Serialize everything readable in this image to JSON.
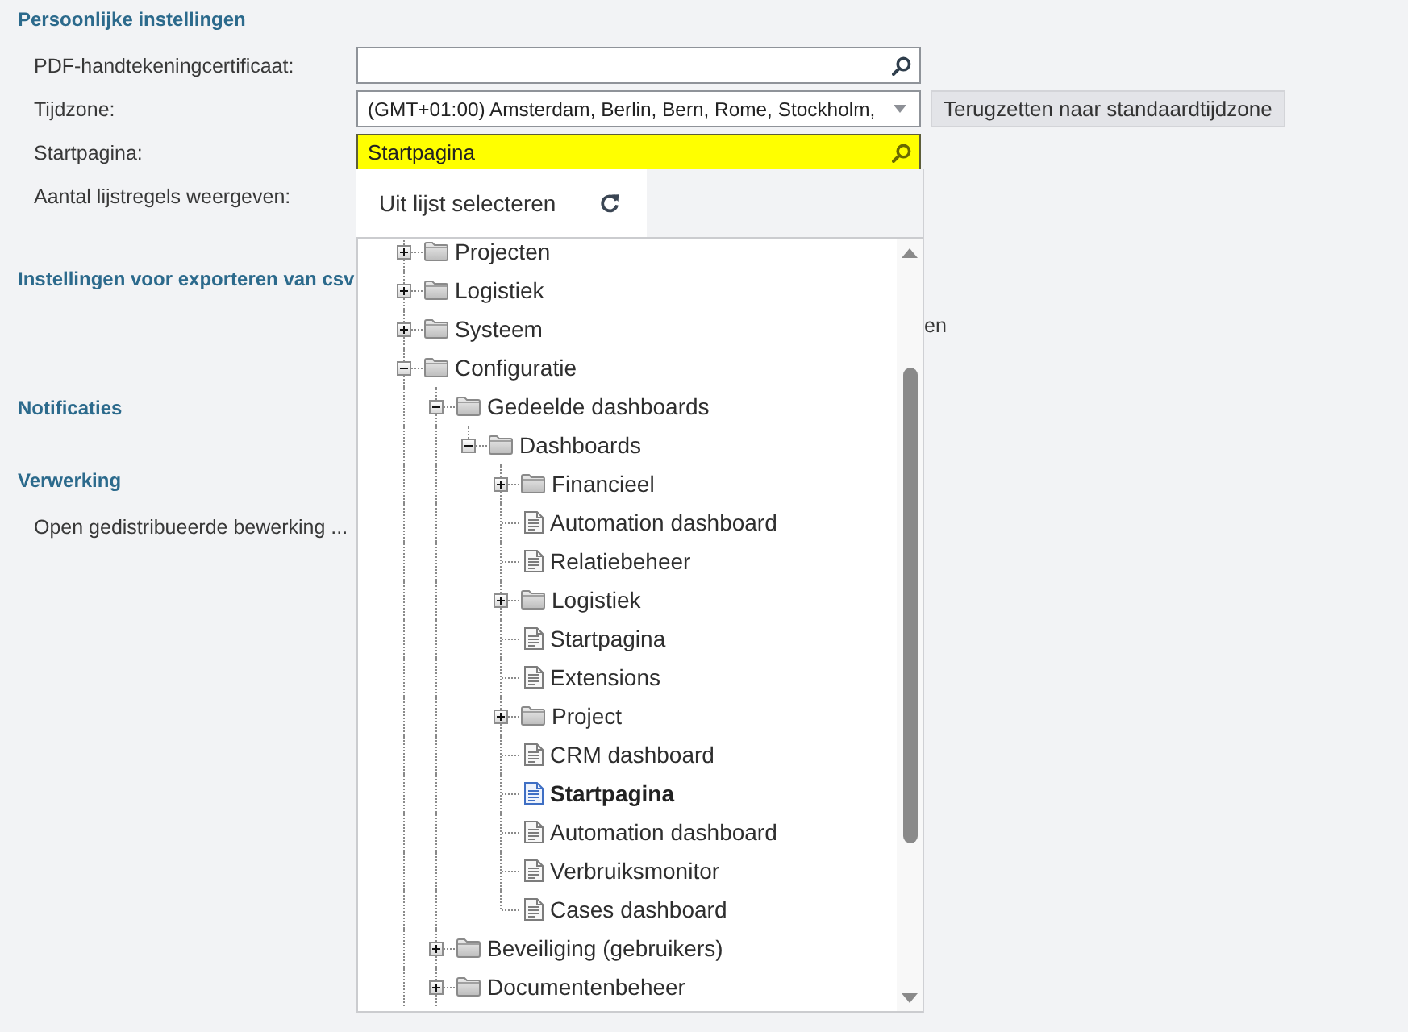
{
  "sections": [
    {
      "title": "Persoonlijke instellingen",
      "rows": [
        {
          "kind": "lookup",
          "label": "PDF-handtekeningcertificaat:",
          "highlighted": false
        },
        {
          "kind": "select",
          "label": "Tijdzone:",
          "value": "(GMT+01:00) Amsterdam, Berlin, Bern, Rome, Stockholm,",
          "button": "Terugzetten naar standaardtijdzone"
        },
        {
          "kind": "lookup",
          "label": "Startpagina:",
          "value": "Startpagina",
          "highlighted": true
        },
        {
          "kind": "plain",
          "label": "Aantal lijstregels weergeven:"
        }
      ]
    },
    {
      "title": "Instellingen voor exporteren van csv",
      "rows": [
        {
          "kind": "tail",
          "label": "en"
        }
      ]
    },
    {
      "title": "Notificaties"
    },
    {
      "title": "Verwerking",
      "rows": [
        {
          "kind": "plain",
          "label": "Open gedistribueerde bewerking ..."
        }
      ]
    }
  ],
  "dropdown": {
    "title": "Uit lijst selecteren",
    "tree": [
      {
        "kind": "folder",
        "label": "Projecten",
        "expanded": false,
        "selected": false
      },
      {
        "kind": "folder",
        "label": "Logistiek",
        "expanded": false,
        "selected": false
      },
      {
        "kind": "folder",
        "label": "Systeem",
        "expanded": false,
        "selected": false
      },
      {
        "kind": "folder",
        "label": "Configuratie",
        "expanded": true,
        "selected": false,
        "children": [
          {
            "kind": "folder",
            "label": "Gedeelde dashboards",
            "expanded": true,
            "selected": false,
            "children": [
              {
                "kind": "folder",
                "label": "Dashboards",
                "expanded": true,
                "selected": false,
                "children": [
                  {
                    "kind": "folder",
                    "label": "Financieel",
                    "expanded": false,
                    "selected": false
                  },
                  {
                    "kind": "document",
                    "label": "Automation dashboard",
                    "selected": false
                  },
                  {
                    "kind": "document",
                    "label": "Relatiebeheer",
                    "selected": false
                  },
                  {
                    "kind": "folder",
                    "label": "Logistiek",
                    "expanded": false,
                    "selected": false
                  },
                  {
                    "kind": "document",
                    "label": "Startpagina",
                    "selected": false
                  },
                  {
                    "kind": "document",
                    "label": "Extensions",
                    "selected": false
                  },
                  {
                    "kind": "folder",
                    "label": "Project",
                    "expanded": false,
                    "selected": false
                  },
                  {
                    "kind": "document",
                    "label": "CRM dashboard",
                    "selected": false
                  },
                  {
                    "kind": "document",
                    "label": "Startpagina",
                    "selected": true
                  },
                  {
                    "kind": "document",
                    "label": "Automation dashboard",
                    "selected": false
                  },
                  {
                    "kind": "document",
                    "label": "Verbruiksmonitor",
                    "selected": false
                  },
                  {
                    "kind": "document",
                    "label": "Cases dashboard",
                    "selected": false
                  }
                ]
              }
            ]
          },
          {
            "kind": "folder",
            "label": "Beveiliging (gebruikers)",
            "expanded": false,
            "selected": false
          },
          {
            "kind": "folder",
            "label": "Documentenbeheer",
            "expanded": false,
            "selected": false
          }
        ]
      }
    ]
  }
}
